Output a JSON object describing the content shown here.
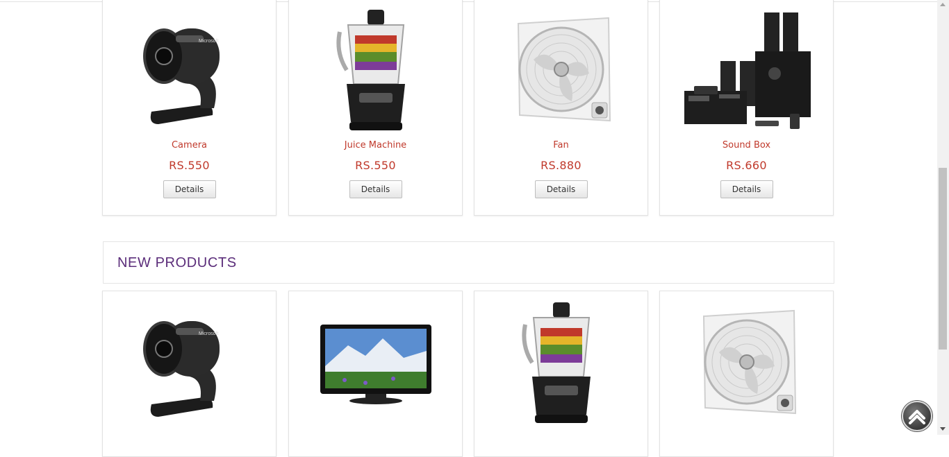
{
  "featured_products": [
    {
      "name": "Camera",
      "price": "RS.550",
      "button": "Details",
      "icon": "webcam-icon"
    },
    {
      "name": "Juice Machine",
      "price": "RS.550",
      "button": "Details",
      "icon": "food-processor-icon"
    },
    {
      "name": "Fan",
      "price": "RS.880",
      "button": "Details",
      "icon": "box-fan-icon"
    },
    {
      "name": "Sound Box",
      "price": "RS.660",
      "button": "Details",
      "icon": "home-theater-icon"
    }
  ],
  "new_products": {
    "title": "NEW PRODUCTS",
    "items": [
      {
        "icon": "webcam-icon"
      },
      {
        "icon": "television-icon"
      },
      {
        "icon": "food-processor-icon"
      },
      {
        "icon": "box-fan-icon"
      }
    ]
  },
  "colors": {
    "price": "#c0392b",
    "section_title": "#5b2d7a"
  },
  "back_to_top_icon": "chevron-up-circle-icon"
}
